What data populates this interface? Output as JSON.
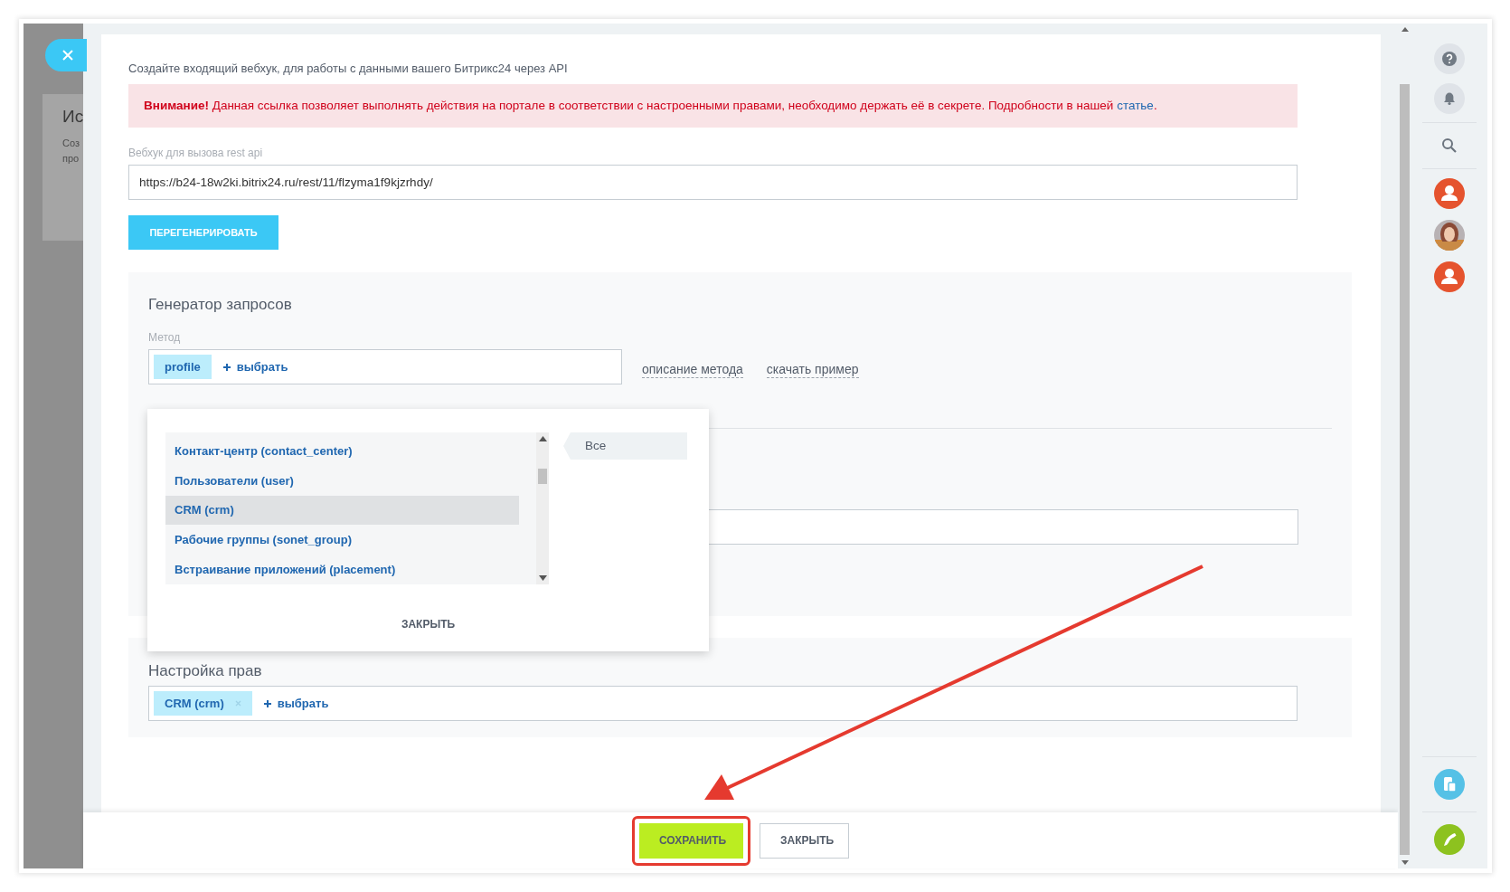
{
  "left_panel": {
    "title": "Ис",
    "lines": [
      "Соз",
      "про"
    ]
  },
  "intro": "Создайте входящий вебхук, для работы с данными вашего Битрикс24 через API",
  "alert": {
    "text": "**Внимание!** Данная ссылка позволяет выполнять действия на портале в соответствии с настроенными правами, необходимо держать её в секрете. Подробности в нашей",
    "link": "статье",
    "tail": "."
  },
  "webhook": {
    "label": "Вебхук для вызова rest api",
    "value": "https://b24-18w2ki.bitrix24.ru/rest/11/flzyma1f9kjzrhdy/",
    "button": "ПЕРЕГЕНЕРИРОВАТЬ"
  },
  "generator": {
    "title": "Генератор запросов",
    "method_label": "Метод",
    "method_tag": "profile",
    "add": "выбрать",
    "links": [
      "описание метода",
      "скачать пример"
    ]
  },
  "scope_popup": {
    "items": [
      {
        "label": "Контакт-центр (contact_center)",
        "selected": false
      },
      {
        "label": "Пользователи (user)",
        "selected": false
      },
      {
        "label": "CRM (crm)",
        "selected": true
      },
      {
        "label": "Рабочие группы (sonet_group)",
        "selected": false
      },
      {
        "label": "Встраивание приложений (placement)",
        "selected": false
      }
    ],
    "categories": [
      {
        "label": "Все",
        "selected": true
      }
    ],
    "close": "ЗАКРЫТЬ"
  },
  "rights": {
    "title": "Настройка прав",
    "tags": [
      "CRM (crm)"
    ],
    "add": "выбрать"
  },
  "footer": {
    "buttons": [
      {
        "label": "СОХРАНИТЬ",
        "kind": "primary",
        "highlighted": true
      },
      {
        "label": "ЗАКРЫТЬ",
        "kind": "secondary",
        "highlighted": false
      }
    ]
  },
  "sidebar": {
    "avatars": [
      {
        "kind": "user"
      },
      {
        "kind": "picture"
      },
      {
        "kind": "user"
      }
    ]
  }
}
